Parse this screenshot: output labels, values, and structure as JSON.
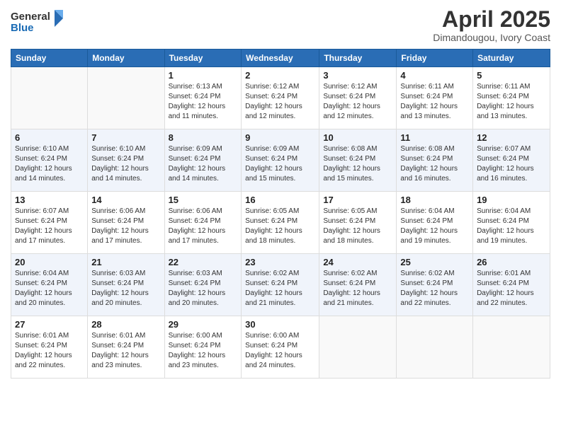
{
  "header": {
    "logo_line1": "General",
    "logo_line2": "Blue",
    "title": "April 2025",
    "subtitle": "Dimandougou, Ivory Coast"
  },
  "columns": [
    "Sunday",
    "Monday",
    "Tuesday",
    "Wednesday",
    "Thursday",
    "Friday",
    "Saturday"
  ],
  "weeks": [
    [
      {
        "day": "",
        "info": ""
      },
      {
        "day": "",
        "info": ""
      },
      {
        "day": "1",
        "info": "Sunrise: 6:13 AM\nSunset: 6:24 PM\nDaylight: 12 hours and 11 minutes."
      },
      {
        "day": "2",
        "info": "Sunrise: 6:12 AM\nSunset: 6:24 PM\nDaylight: 12 hours and 12 minutes."
      },
      {
        "day": "3",
        "info": "Sunrise: 6:12 AM\nSunset: 6:24 PM\nDaylight: 12 hours and 12 minutes."
      },
      {
        "day": "4",
        "info": "Sunrise: 6:11 AM\nSunset: 6:24 PM\nDaylight: 12 hours and 13 minutes."
      },
      {
        "day": "5",
        "info": "Sunrise: 6:11 AM\nSunset: 6:24 PM\nDaylight: 12 hours and 13 minutes."
      }
    ],
    [
      {
        "day": "6",
        "info": "Sunrise: 6:10 AM\nSunset: 6:24 PM\nDaylight: 12 hours and 14 minutes."
      },
      {
        "day": "7",
        "info": "Sunrise: 6:10 AM\nSunset: 6:24 PM\nDaylight: 12 hours and 14 minutes."
      },
      {
        "day": "8",
        "info": "Sunrise: 6:09 AM\nSunset: 6:24 PM\nDaylight: 12 hours and 14 minutes."
      },
      {
        "day": "9",
        "info": "Sunrise: 6:09 AM\nSunset: 6:24 PM\nDaylight: 12 hours and 15 minutes."
      },
      {
        "day": "10",
        "info": "Sunrise: 6:08 AM\nSunset: 6:24 PM\nDaylight: 12 hours and 15 minutes."
      },
      {
        "day": "11",
        "info": "Sunrise: 6:08 AM\nSunset: 6:24 PM\nDaylight: 12 hours and 16 minutes."
      },
      {
        "day": "12",
        "info": "Sunrise: 6:07 AM\nSunset: 6:24 PM\nDaylight: 12 hours and 16 minutes."
      }
    ],
    [
      {
        "day": "13",
        "info": "Sunrise: 6:07 AM\nSunset: 6:24 PM\nDaylight: 12 hours and 17 minutes."
      },
      {
        "day": "14",
        "info": "Sunrise: 6:06 AM\nSunset: 6:24 PM\nDaylight: 12 hours and 17 minutes."
      },
      {
        "day": "15",
        "info": "Sunrise: 6:06 AM\nSunset: 6:24 PM\nDaylight: 12 hours and 17 minutes."
      },
      {
        "day": "16",
        "info": "Sunrise: 6:05 AM\nSunset: 6:24 PM\nDaylight: 12 hours and 18 minutes."
      },
      {
        "day": "17",
        "info": "Sunrise: 6:05 AM\nSunset: 6:24 PM\nDaylight: 12 hours and 18 minutes."
      },
      {
        "day": "18",
        "info": "Sunrise: 6:04 AM\nSunset: 6:24 PM\nDaylight: 12 hours and 19 minutes."
      },
      {
        "day": "19",
        "info": "Sunrise: 6:04 AM\nSunset: 6:24 PM\nDaylight: 12 hours and 19 minutes."
      }
    ],
    [
      {
        "day": "20",
        "info": "Sunrise: 6:04 AM\nSunset: 6:24 PM\nDaylight: 12 hours and 20 minutes."
      },
      {
        "day": "21",
        "info": "Sunrise: 6:03 AM\nSunset: 6:24 PM\nDaylight: 12 hours and 20 minutes."
      },
      {
        "day": "22",
        "info": "Sunrise: 6:03 AM\nSunset: 6:24 PM\nDaylight: 12 hours and 20 minutes."
      },
      {
        "day": "23",
        "info": "Sunrise: 6:02 AM\nSunset: 6:24 PM\nDaylight: 12 hours and 21 minutes."
      },
      {
        "day": "24",
        "info": "Sunrise: 6:02 AM\nSunset: 6:24 PM\nDaylight: 12 hours and 21 minutes."
      },
      {
        "day": "25",
        "info": "Sunrise: 6:02 AM\nSunset: 6:24 PM\nDaylight: 12 hours and 22 minutes."
      },
      {
        "day": "26",
        "info": "Sunrise: 6:01 AM\nSunset: 6:24 PM\nDaylight: 12 hours and 22 minutes."
      }
    ],
    [
      {
        "day": "27",
        "info": "Sunrise: 6:01 AM\nSunset: 6:24 PM\nDaylight: 12 hours and 22 minutes."
      },
      {
        "day": "28",
        "info": "Sunrise: 6:01 AM\nSunset: 6:24 PM\nDaylight: 12 hours and 23 minutes."
      },
      {
        "day": "29",
        "info": "Sunrise: 6:00 AM\nSunset: 6:24 PM\nDaylight: 12 hours and 23 minutes."
      },
      {
        "day": "30",
        "info": "Sunrise: 6:00 AM\nSunset: 6:24 PM\nDaylight: 12 hours and 24 minutes."
      },
      {
        "day": "",
        "info": ""
      },
      {
        "day": "",
        "info": ""
      },
      {
        "day": "",
        "info": ""
      }
    ]
  ]
}
